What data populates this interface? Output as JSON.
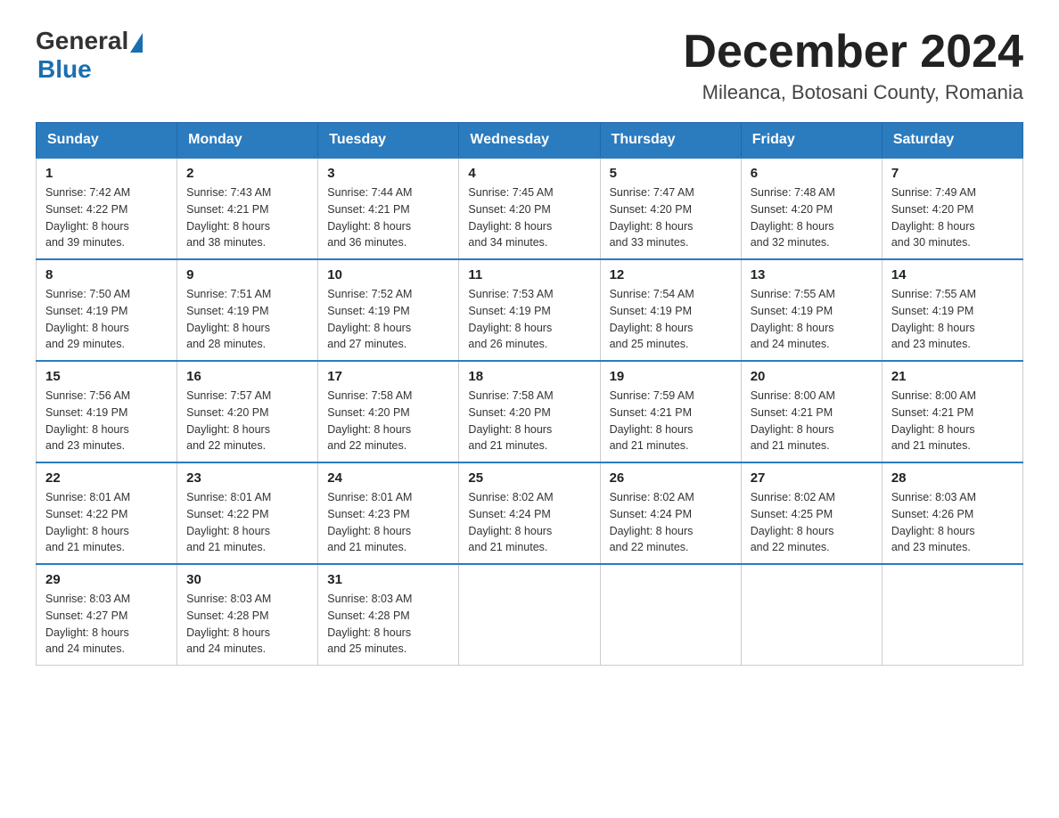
{
  "logo": {
    "general": "General",
    "blue": "Blue"
  },
  "title": {
    "month_year": "December 2024",
    "location": "Mileanca, Botosani County, Romania"
  },
  "headers": [
    "Sunday",
    "Monday",
    "Tuesday",
    "Wednesday",
    "Thursday",
    "Friday",
    "Saturday"
  ],
  "weeks": [
    [
      {
        "day": "1",
        "sunrise": "7:42 AM",
        "sunset": "4:22 PM",
        "daylight": "8 hours and 39 minutes."
      },
      {
        "day": "2",
        "sunrise": "7:43 AM",
        "sunset": "4:21 PM",
        "daylight": "8 hours and 38 minutes."
      },
      {
        "day": "3",
        "sunrise": "7:44 AM",
        "sunset": "4:21 PM",
        "daylight": "8 hours and 36 minutes."
      },
      {
        "day": "4",
        "sunrise": "7:45 AM",
        "sunset": "4:20 PM",
        "daylight": "8 hours and 34 minutes."
      },
      {
        "day": "5",
        "sunrise": "7:47 AM",
        "sunset": "4:20 PM",
        "daylight": "8 hours and 33 minutes."
      },
      {
        "day": "6",
        "sunrise": "7:48 AM",
        "sunset": "4:20 PM",
        "daylight": "8 hours and 32 minutes."
      },
      {
        "day": "7",
        "sunrise": "7:49 AM",
        "sunset": "4:20 PM",
        "daylight": "8 hours and 30 minutes."
      }
    ],
    [
      {
        "day": "8",
        "sunrise": "7:50 AM",
        "sunset": "4:19 PM",
        "daylight": "8 hours and 29 minutes."
      },
      {
        "day": "9",
        "sunrise": "7:51 AM",
        "sunset": "4:19 PM",
        "daylight": "8 hours and 28 minutes."
      },
      {
        "day": "10",
        "sunrise": "7:52 AM",
        "sunset": "4:19 PM",
        "daylight": "8 hours and 27 minutes."
      },
      {
        "day": "11",
        "sunrise": "7:53 AM",
        "sunset": "4:19 PM",
        "daylight": "8 hours and 26 minutes."
      },
      {
        "day": "12",
        "sunrise": "7:54 AM",
        "sunset": "4:19 PM",
        "daylight": "8 hours and 25 minutes."
      },
      {
        "day": "13",
        "sunrise": "7:55 AM",
        "sunset": "4:19 PM",
        "daylight": "8 hours and 24 minutes."
      },
      {
        "day": "14",
        "sunrise": "7:55 AM",
        "sunset": "4:19 PM",
        "daylight": "8 hours and 23 minutes."
      }
    ],
    [
      {
        "day": "15",
        "sunrise": "7:56 AM",
        "sunset": "4:19 PM",
        "daylight": "8 hours and 23 minutes."
      },
      {
        "day": "16",
        "sunrise": "7:57 AM",
        "sunset": "4:20 PM",
        "daylight": "8 hours and 22 minutes."
      },
      {
        "day": "17",
        "sunrise": "7:58 AM",
        "sunset": "4:20 PM",
        "daylight": "8 hours and 22 minutes."
      },
      {
        "day": "18",
        "sunrise": "7:58 AM",
        "sunset": "4:20 PM",
        "daylight": "8 hours and 21 minutes."
      },
      {
        "day": "19",
        "sunrise": "7:59 AM",
        "sunset": "4:21 PM",
        "daylight": "8 hours and 21 minutes."
      },
      {
        "day": "20",
        "sunrise": "8:00 AM",
        "sunset": "4:21 PM",
        "daylight": "8 hours and 21 minutes."
      },
      {
        "day": "21",
        "sunrise": "8:00 AM",
        "sunset": "4:21 PM",
        "daylight": "8 hours and 21 minutes."
      }
    ],
    [
      {
        "day": "22",
        "sunrise": "8:01 AM",
        "sunset": "4:22 PM",
        "daylight": "8 hours and 21 minutes."
      },
      {
        "day": "23",
        "sunrise": "8:01 AM",
        "sunset": "4:22 PM",
        "daylight": "8 hours and 21 minutes."
      },
      {
        "day": "24",
        "sunrise": "8:01 AM",
        "sunset": "4:23 PM",
        "daylight": "8 hours and 21 minutes."
      },
      {
        "day": "25",
        "sunrise": "8:02 AM",
        "sunset": "4:24 PM",
        "daylight": "8 hours and 21 minutes."
      },
      {
        "day": "26",
        "sunrise": "8:02 AM",
        "sunset": "4:24 PM",
        "daylight": "8 hours and 22 minutes."
      },
      {
        "day": "27",
        "sunrise": "8:02 AM",
        "sunset": "4:25 PM",
        "daylight": "8 hours and 22 minutes."
      },
      {
        "day": "28",
        "sunrise": "8:03 AM",
        "sunset": "4:26 PM",
        "daylight": "8 hours and 23 minutes."
      }
    ],
    [
      {
        "day": "29",
        "sunrise": "8:03 AM",
        "sunset": "4:27 PM",
        "daylight": "8 hours and 24 minutes."
      },
      {
        "day": "30",
        "sunrise": "8:03 AM",
        "sunset": "4:28 PM",
        "daylight": "8 hours and 24 minutes."
      },
      {
        "day": "31",
        "sunrise": "8:03 AM",
        "sunset": "4:28 PM",
        "daylight": "8 hours and 25 minutes."
      },
      null,
      null,
      null,
      null
    ]
  ],
  "labels": {
    "sunrise": "Sunrise:",
    "sunset": "Sunset:",
    "daylight": "Daylight:"
  }
}
